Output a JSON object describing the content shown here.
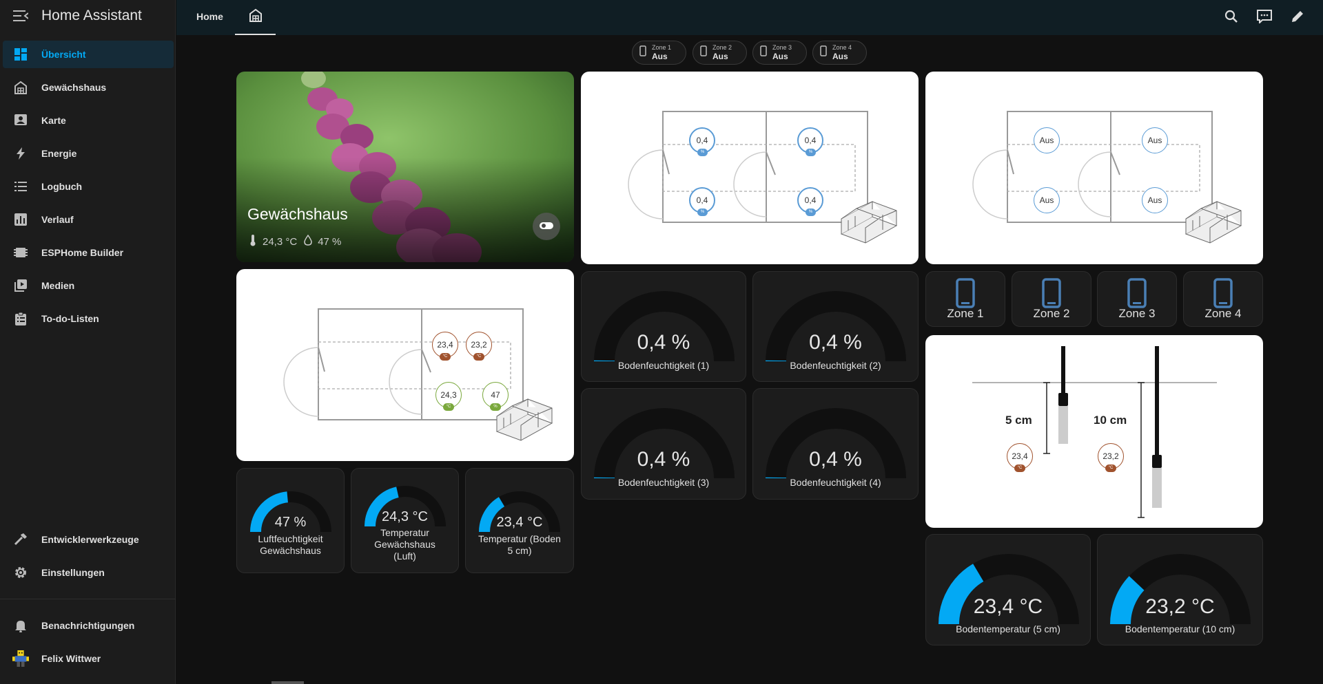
{
  "app": {
    "title": "Home Assistant"
  },
  "sidebar": {
    "items": [
      {
        "label": "Übersicht",
        "icon": "dashboard-icon",
        "active": true
      },
      {
        "label": "Gewächshaus",
        "icon": "greenhouse-icon"
      },
      {
        "label": "Karte",
        "icon": "map-account-icon"
      },
      {
        "label": "Energie",
        "icon": "lightning-icon"
      },
      {
        "label": "Logbuch",
        "icon": "list-icon"
      },
      {
        "label": "Verlauf",
        "icon": "chart-box-icon"
      },
      {
        "label": "ESPHome Builder",
        "icon": "esphome-icon"
      },
      {
        "label": "Medien",
        "icon": "play-box-icon"
      },
      {
        "label": "To-do-Listen",
        "icon": "clipboard-list-icon"
      }
    ],
    "bottom": [
      {
        "label": "Entwicklerwerkzeuge",
        "icon": "hammer-icon"
      },
      {
        "label": "Einstellungen",
        "icon": "gear-icon"
      }
    ],
    "notifications": "Benachrichtigungen",
    "user": "Felix Wittwer"
  },
  "header": {
    "tab_home": "Home"
  },
  "chips": [
    {
      "zone": "Zone 1",
      "state": "Aus"
    },
    {
      "zone": "Zone 2",
      "state": "Aus"
    },
    {
      "zone": "Zone 3",
      "state": "Aus"
    },
    {
      "zone": "Zone 4",
      "state": "Aus"
    }
  ],
  "area_card": {
    "name": "Gewächshaus",
    "temperature": "24,3 °C",
    "humidity": "47 %"
  },
  "plan_moisture": {
    "values": [
      "0,4",
      "0,4",
      "0,4",
      "0,4"
    ],
    "unit": "%"
  },
  "plan_valves": {
    "values": [
      "Aus",
      "Aus",
      "Aus",
      "Aus"
    ]
  },
  "plan_climate": {
    "temps": [
      "23,4",
      "23,2"
    ],
    "temp_unit": "°C",
    "air_temp": "24,3",
    "air_temp_unit": "°C",
    "air_hum": "47",
    "air_hum_unit": "%"
  },
  "soil_gauges": [
    {
      "value": "0,4 %",
      "label": "Bodenfeuchtigkeit (1)",
      "fraction": 0.004
    },
    {
      "value": "0,4 %",
      "label": "Bodenfeuchtigkeit (2)",
      "fraction": 0.004
    },
    {
      "value": "0,4 %",
      "label": "Bodenfeuchtigkeit (3)",
      "fraction": 0.004
    },
    {
      "value": "0,4 %",
      "label": "Bodenfeuchtigkeit (4)",
      "fraction": 0.004
    }
  ],
  "small_gauges": [
    {
      "value": "47 %",
      "label_lines": [
        "Luftfeuchtigkeit",
        "Gewächshaus"
      ],
      "fraction": 0.47
    },
    {
      "value": "24,3 °C",
      "label_lines": [
        "Temperatur",
        "Gewächshaus",
        "(Luft)"
      ],
      "fraction": 0.43
    },
    {
      "value": "23,4 °C",
      "label_lines": [
        "Temperatur (Boden",
        "5 cm)"
      ],
      "fraction": 0.33
    }
  ],
  "zones": [
    "Zone 1",
    "Zone 2",
    "Zone 3",
    "Zone 4"
  ],
  "depth_card": {
    "d1": "5 cm",
    "d2": "10 cm",
    "t1": "23,4",
    "t2": "23,2",
    "unit": "°C"
  },
  "soil_temp_gauges": [
    {
      "value": "23,4 °C",
      "label": "Bodentemperatur (5 cm)",
      "fraction": 0.33
    },
    {
      "value": "23,2 °C",
      "label": "Bodentemperatur (10 cm)",
      "fraction": 0.24
    }
  ],
  "colors": {
    "accent": "#03a9f4",
    "gauge_track": "#101010",
    "valve": "#5a9bd5",
    "temp_badge": "#a0522d",
    "hum_badge": "#7aa83c"
  }
}
